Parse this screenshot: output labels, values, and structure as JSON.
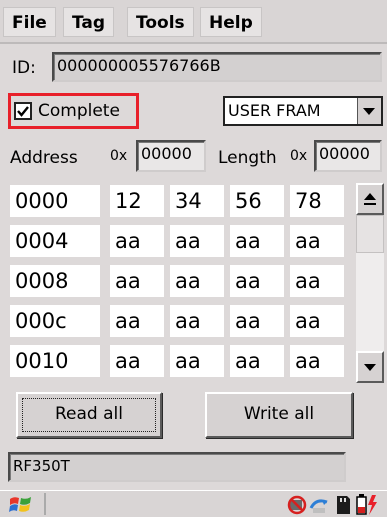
{
  "menu": {
    "file": "File",
    "tag": "Tag",
    "tools": "Tools",
    "help": "Help"
  },
  "id_label": "ID:",
  "id_value": "000000005576766B",
  "complete_label": "Complete",
  "complete_checked": true,
  "memory_select": "USER FRAM",
  "address_label": "Address",
  "address_prefix": "0x",
  "address_value": "00000",
  "length_label": "Length",
  "length_prefix": "0x",
  "length_value": "00000",
  "rows": [
    {
      "addr": "0000",
      "bytes": [
        "12",
        "34",
        "56",
        "78"
      ]
    },
    {
      "addr": "0004",
      "bytes": [
        "aa",
        "aa",
        "aa",
        "aa"
      ]
    },
    {
      "addr": "0008",
      "bytes": [
        "aa",
        "aa",
        "aa",
        "aa"
      ]
    },
    {
      "addr": "000c",
      "bytes": [
        "aa",
        "aa",
        "aa",
        "aa"
      ]
    },
    {
      "addr": "0010",
      "bytes": [
        "aa",
        "aa",
        "aa",
        "aa"
      ]
    }
  ],
  "read_all": "Read all",
  "write_all": "Write all",
  "status": "RF350T",
  "colors": {
    "highlight_border": "#e8202a",
    "background": "#ddd9d9"
  },
  "taskbar": {
    "start_icon": "windows-flag-icon",
    "tray_icons": [
      "no-network-icon",
      "sync-icon",
      "sd-card-icon",
      "battery-charging-icon"
    ]
  }
}
